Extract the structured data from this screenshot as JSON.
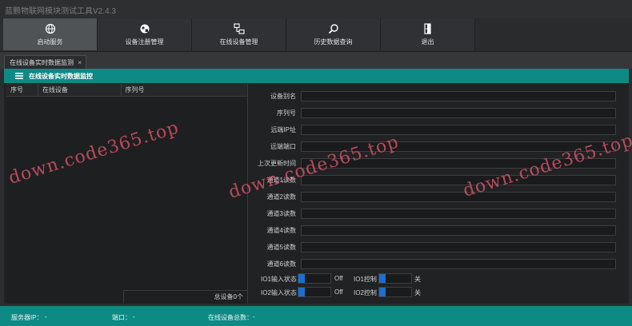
{
  "app": {
    "title": "蓝鹏物联网模块测试工具V2.4.3"
  },
  "toolbar": {
    "buttons": [
      {
        "label": "启动服务",
        "icon": "globe-icon"
      },
      {
        "label": "设备注册管理",
        "icon": "devices-icon"
      },
      {
        "label": "在线设备管理",
        "icon": "network-icon"
      },
      {
        "label": "历史数据查询",
        "icon": "search-icon"
      },
      {
        "label": "退出",
        "icon": "exit-icon"
      }
    ]
  },
  "tab": {
    "label": "在线设备实时数据监测",
    "close": "×"
  },
  "panel": {
    "title": "在线设备实时数据监控"
  },
  "device_list": {
    "columns": [
      "序号",
      "在线设备",
      "序列号"
    ],
    "rows": [],
    "total_label": "总设备0个"
  },
  "form": {
    "fields": [
      {
        "label": "设备别名",
        "value": ""
      },
      {
        "label": "序列号",
        "value": ""
      },
      {
        "label": "远端IP址",
        "value": ""
      },
      {
        "label": "远端端口",
        "value": ""
      },
      {
        "label": "上次更新时间",
        "value": ""
      },
      {
        "label": "通道1读数",
        "value": ""
      },
      {
        "label": "通道2读数",
        "value": ""
      },
      {
        "label": "通道3读数",
        "value": ""
      },
      {
        "label": "通道4读数",
        "value": ""
      },
      {
        "label": "通道5读数",
        "value": ""
      },
      {
        "label": "通道6读数",
        "value": ""
      }
    ],
    "io": [
      {
        "input_label": "IO1输入状态",
        "input_state": "Off",
        "control_label": "IO1控制",
        "control_state": "关"
      },
      {
        "input_label": "IO2输入状态",
        "input_state": "Off",
        "control_label": "IO2控制",
        "control_state": "关"
      }
    ]
  },
  "statusbar": {
    "server_ip_label": "服务器IP：",
    "server_ip_value": "-",
    "port_label": "端口：",
    "port_value": "-",
    "online_total_label": "在线设备总数：",
    "online_total_value": "-"
  },
  "watermark": {
    "text": "down.code365.top"
  },
  "colors": {
    "accent": "#0e8a85",
    "toggle": "#1a6fd0",
    "watermark": "#eb5a6e"
  }
}
